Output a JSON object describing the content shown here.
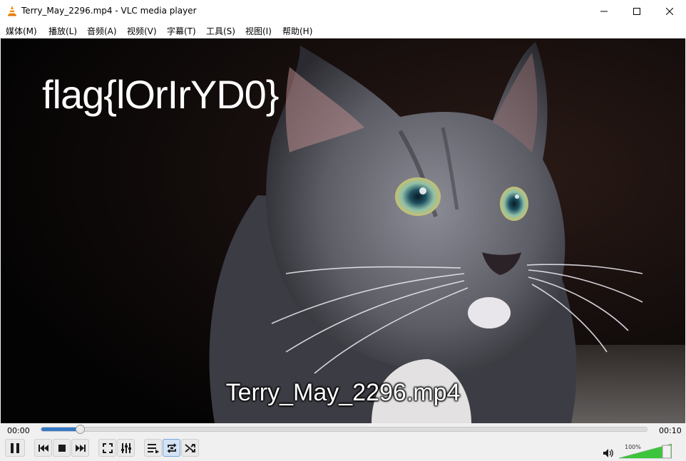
{
  "window": {
    "title": "Terry_May_2296.mp4 - VLC media player",
    "app_icon": "vlc-cone-icon",
    "controls": [
      "minimize-icon",
      "maximize-icon",
      "close-icon"
    ]
  },
  "menu": {
    "items": [
      {
        "label": "媒体(M)"
      },
      {
        "label": "播放(L)"
      },
      {
        "label": "音频(A)"
      },
      {
        "label": "视频(V)"
      },
      {
        "label": "字幕(T)"
      },
      {
        "label": "工具(S)"
      },
      {
        "label": "视图(I)"
      },
      {
        "label": "帮助(H)"
      }
    ]
  },
  "video": {
    "overlay_text": "flag{lOrIrYD0}",
    "filename_osd": "Terry_May_2296.mp4"
  },
  "playback": {
    "elapsed": "00:00",
    "duration": "00:10",
    "progress_fraction": 0.063
  },
  "buttons": {
    "play_pause": "pause-icon",
    "previous": "skip-previous-icon",
    "stop": "stop-icon",
    "next": "skip-next-icon",
    "fullscreen": "fullscreen-icon",
    "extended_settings": "equalizer-sliders-icon",
    "playlist": "playlist-icon",
    "loop": "loop-icon",
    "shuffle": "shuffle-icon"
  },
  "volume": {
    "label": "100%",
    "level_fraction": 1.0,
    "icon": "speaker-icon"
  },
  "colors": {
    "seek_fill": "#3478c6",
    "volume_fill": "#3cc43c",
    "vlc_orange": "#f08a00"
  }
}
